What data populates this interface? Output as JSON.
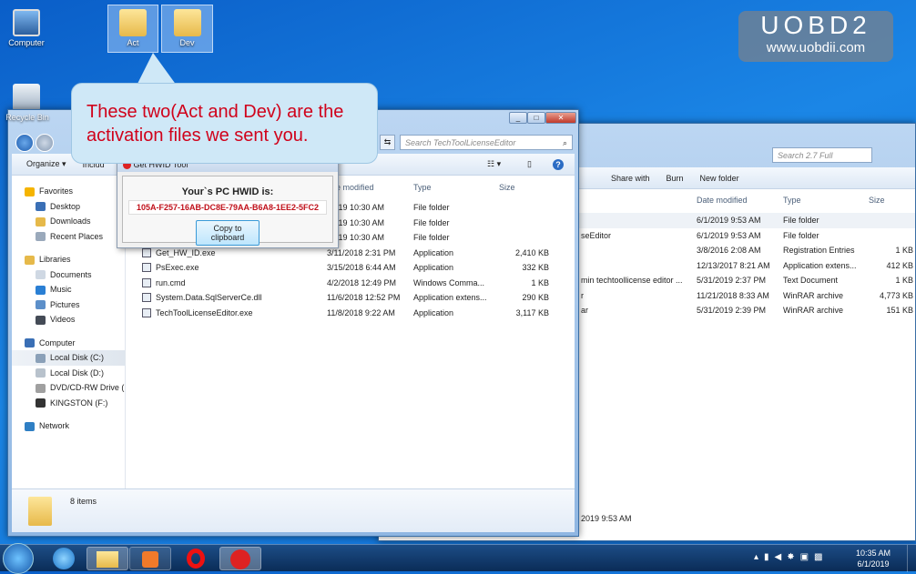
{
  "desktop": {
    "icons": [
      {
        "label": "Computer"
      },
      {
        "label": "Recycle Bin"
      },
      {
        "label": "Act"
      },
      {
        "label": "Dev"
      }
    ]
  },
  "watermark": {
    "brand": "UOBD2",
    "url": "www.uobdii.com"
  },
  "callout": {
    "text": "These two(Act and Dev) are the activation files we sent you."
  },
  "back_window": {
    "search_placeholder": "Search 2.7 Full",
    "toolbar": [
      "Share with",
      "Burn",
      "New folder"
    ],
    "columns": [
      "Date modified",
      "Type",
      "Size"
    ],
    "rows": [
      {
        "name": "",
        "date": "6/1/2019 9:53 AM",
        "type": "File folder",
        "size": ""
      },
      {
        "name": "seEditor",
        "date": "6/1/2019 9:53 AM",
        "type": "File folder",
        "size": ""
      },
      {
        "name": "",
        "date": "3/8/2016 2:08 AM",
        "type": "Registration Entries",
        "size": "1 KB"
      },
      {
        "name": "",
        "date": "12/13/2017 8:21 AM",
        "type": "Application extens...",
        "size": "412 KB"
      },
      {
        "name": "min techtoollicense editor ...",
        "date": "5/31/2019 2:37 PM",
        "type": "Text Document",
        "size": "1 KB"
      },
      {
        "name": "r",
        "date": "11/21/2018 8:33 AM",
        "type": "WinRAR archive",
        "size": "4,773 KB"
      },
      {
        "name": "ar",
        "date": "5/31/2019 2:39 PM",
        "type": "WinRAR archive",
        "size": "151 KB"
      }
    ],
    "status_date": "2019 9:53 AM"
  },
  "front_window": {
    "search_placeholder": "Search TechToolLicenseEditor",
    "toolbar": {
      "organize": "Organize",
      "include": "Includ"
    },
    "columns": [
      "e modified",
      "Type",
      "Size"
    ],
    "nav": [
      {
        "label": "Favorites",
        "level": 0,
        "color": "#f5b400"
      },
      {
        "label": "Desktop",
        "level": 1,
        "color": "#3a6fb5"
      },
      {
        "label": "Downloads",
        "level": 1,
        "color": "#e6b94a"
      },
      {
        "label": "Recent Places",
        "level": 1,
        "color": "#9aa9bb"
      },
      {
        "label": "",
        "level": -1
      },
      {
        "label": "Libraries",
        "level": 0,
        "color": "#e6b94a"
      },
      {
        "label": "Documents",
        "level": 1,
        "color": "#cfd8e3"
      },
      {
        "label": "Music",
        "level": 1,
        "color": "#2a7fd4"
      },
      {
        "label": "Pictures",
        "level": 1,
        "color": "#5c8fc9"
      },
      {
        "label": "Videos",
        "level": 1,
        "color": "#444b56"
      },
      {
        "label": "",
        "level": -1
      },
      {
        "label": "Computer",
        "level": 0,
        "color": "#3a6fb5"
      },
      {
        "label": "Local Disk (C:)",
        "level": 1,
        "color": "#8aa0b8",
        "selected": true
      },
      {
        "label": "Local Disk (D:)",
        "level": 1,
        "color": "#b8c2cc"
      },
      {
        "label": "DVD/CD-RW Drive (I",
        "level": 1,
        "color": "#a0a0a0"
      },
      {
        "label": "KINGSTON (F:)",
        "level": 1,
        "color": "#333"
      },
      {
        "label": "",
        "level": -1
      },
      {
        "label": "Network",
        "level": 0,
        "color": "#2f7fc4"
      }
    ],
    "rows": [
      {
        "name": "",
        "date": "/2019 10:30 AM",
        "type": "File folder",
        "size": ""
      },
      {
        "name": "",
        "date": "/2019 10:30 AM",
        "type": "File folder",
        "size": ""
      },
      {
        "name": "",
        "date": "/2019 10:30 AM",
        "type": "File folder",
        "size": ""
      },
      {
        "name": "Get_HW_ID.exe",
        "date": "3/11/2018 2:31 PM",
        "type": "Application",
        "size": "2,410 KB"
      },
      {
        "name": "PsExec.exe",
        "date": "3/15/2018 6:44 AM",
        "type": "Application",
        "size": "332 KB"
      },
      {
        "name": "run.cmd",
        "date": "4/2/2018 12:49 PM",
        "type": "Windows Comma...",
        "size": "1 KB"
      },
      {
        "name": "System.Data.SqlServerCe.dll",
        "date": "11/6/2018 12:52 PM",
        "type": "Application extens...",
        "size": "290 KB"
      },
      {
        "name": "TechToolLicenseEditor.exe",
        "date": "11/8/2018 9:22 AM",
        "type": "Application",
        "size": "3,117 KB"
      }
    ],
    "status": "8 items"
  },
  "hwid_dialog": {
    "title": "Get HWID Tool",
    "heading": "Your`s PC HWID is:",
    "hwid": "105A-F257-16AB-DC8E-79AA-B6A8-1EE2-5FC2",
    "copy_button": "Copy to clipboard"
  },
  "tray": {
    "time": "10:35 AM",
    "date": "6/1/2019"
  },
  "colors": {
    "callout_text": "#d0021b",
    "hwid_text": "#c0101a",
    "callout_bg": "#cfe8f7"
  }
}
